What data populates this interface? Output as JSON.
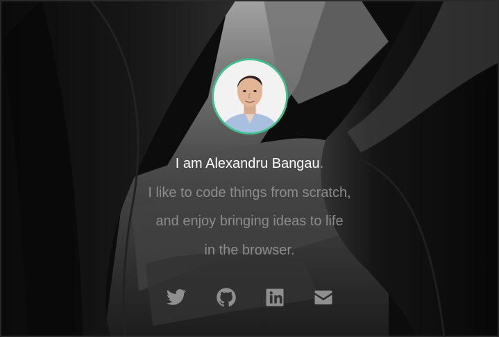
{
  "profile": {
    "intro_prefix": "I am ",
    "name": "Alexandru Bangau",
    "intro_suffix": ".",
    "tagline_lines": [
      "I like to code things from scratch,",
      "and enjoy bringing ideas to life",
      "in the browser."
    ],
    "avatar_alt": "Alexandru Bangau"
  },
  "social_links": [
    {
      "name": "twitter",
      "icon": "twitter-icon"
    },
    {
      "name": "github",
      "icon": "github-icon"
    },
    {
      "name": "linkedin",
      "icon": "linkedin-icon"
    },
    {
      "name": "email",
      "icon": "envelope-icon"
    }
  ],
  "colors": {
    "avatar_ring": "#3fbf8f",
    "name_text": "#ffffff",
    "tagline_text": "#8c8c8c",
    "icon": "#8f8f8f"
  }
}
